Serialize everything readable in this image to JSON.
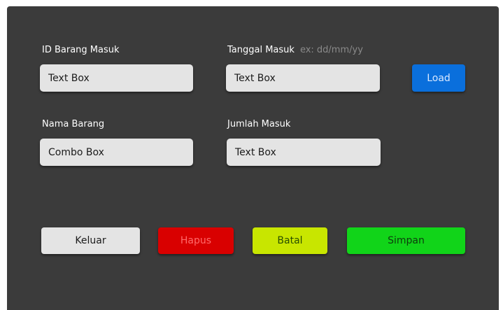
{
  "form": {
    "id_label": "ID Barang Masuk",
    "id_value": "Text Box",
    "date_label": "Tanggal Masuk",
    "date_hint": "ex: dd/mm/yy",
    "date_value": "Text Box",
    "load_label": "Load",
    "name_label": "Nama Barang",
    "name_value": "Combo Box",
    "qty_label": "Jumlah Masuk",
    "qty_value": "Text Box"
  },
  "actions": {
    "exit_label": "Keluar",
    "delete_label": "Hapus",
    "cancel_label": "Batal",
    "save_label": "Simpan"
  },
  "colors": {
    "panel": "#3b3b3b",
    "field": "#e4e4e4",
    "load": "#0a6fdc",
    "exit": "#e4e4e4",
    "delete": "#d90000",
    "cancel": "#c8e600",
    "save": "#11d419"
  }
}
